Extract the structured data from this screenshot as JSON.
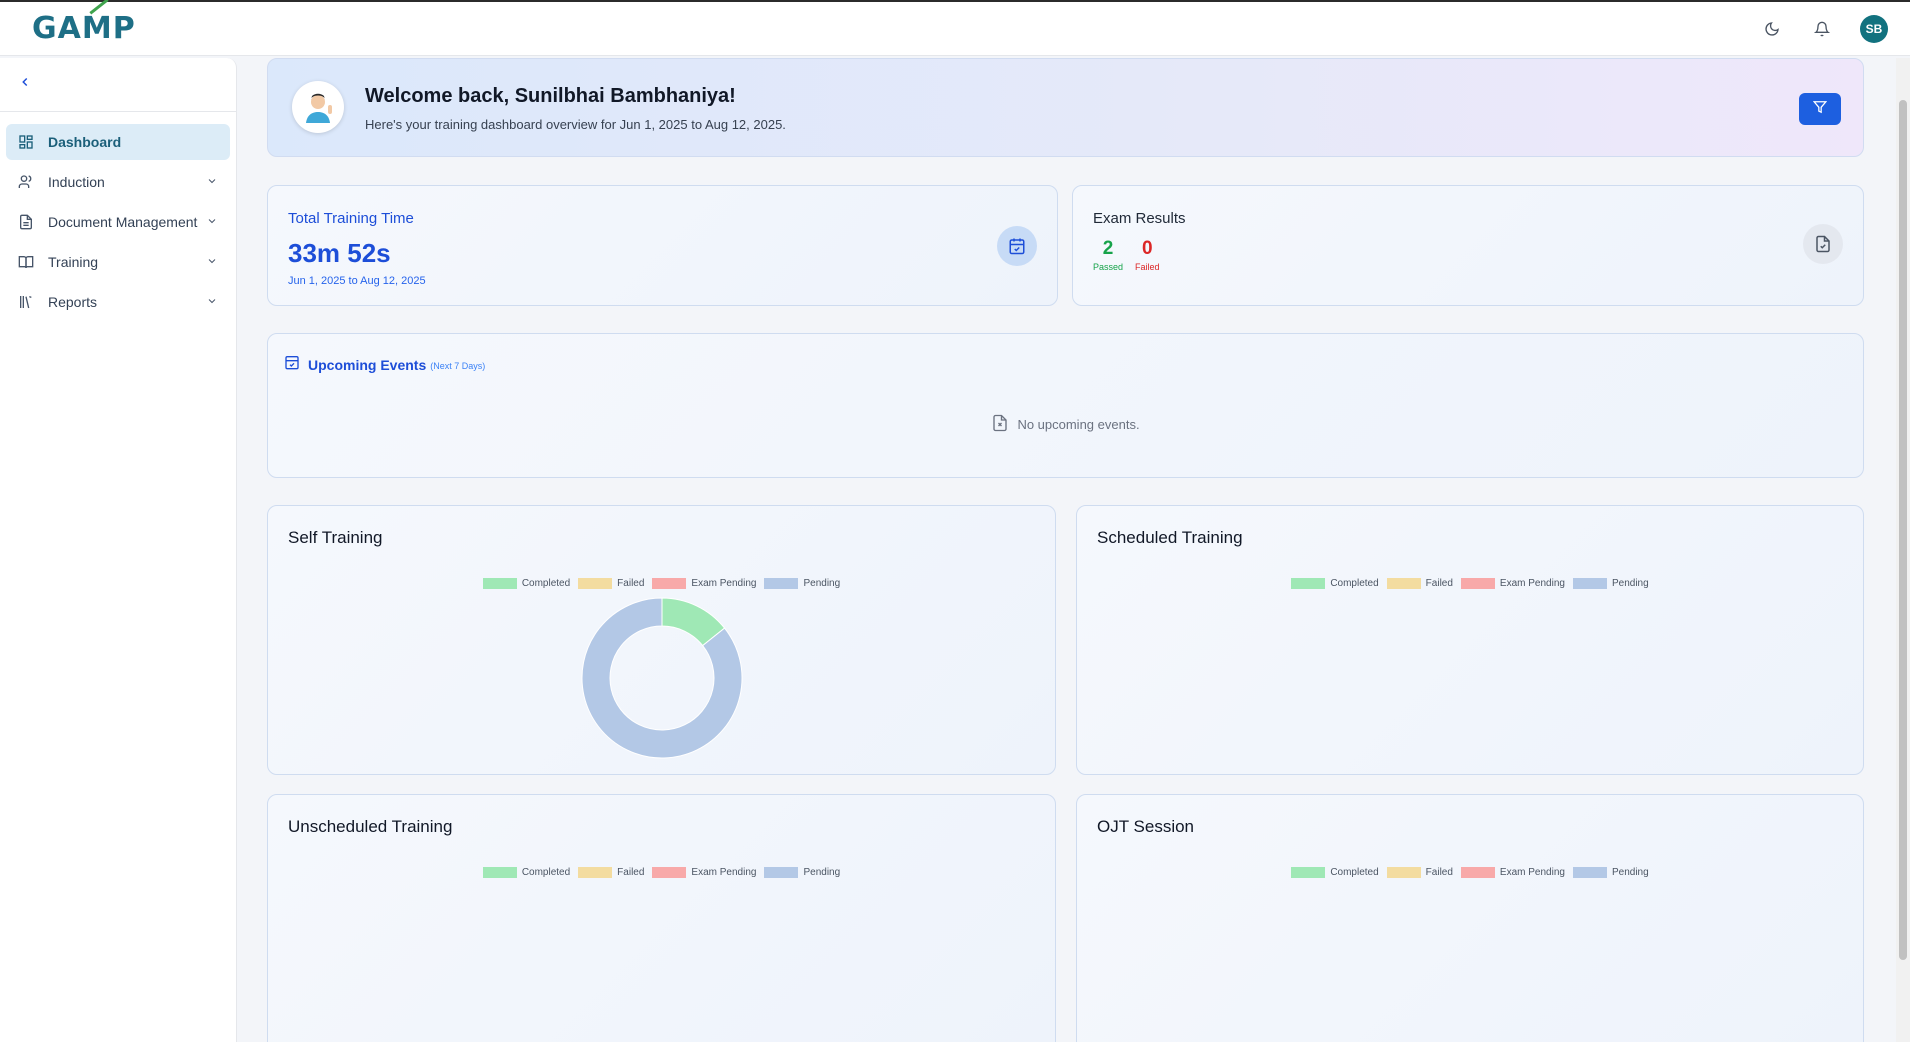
{
  "app": {
    "logo": "GAMP",
    "user_initials": "SB"
  },
  "icons": {
    "theme": "moon-icon",
    "notifications": "bell-icon",
    "filter": "filter-icon"
  },
  "sidebar": {
    "items": [
      {
        "label": "Dashboard",
        "icon": "dashboard-icon",
        "active": true
      },
      {
        "label": "Induction",
        "icon": "users-icon"
      },
      {
        "label": "Document Management",
        "icon": "document-icon"
      },
      {
        "label": "Training",
        "icon": "book-icon"
      },
      {
        "label": "Reports",
        "icon": "library-icon"
      }
    ]
  },
  "welcome": {
    "title": "Welcome back, Sunilbhai Bambhaniya!",
    "subtitle": "Here's your training dashboard overview for Jun 1, 2025 to Aug 12, 2025."
  },
  "training_time": {
    "label": "Total Training Time",
    "value": "33m 52s",
    "range": "Jun 1, 2025 to Aug 12, 2025"
  },
  "exam_results": {
    "label": "Exam Results",
    "passed": "2",
    "passed_label": "Passed",
    "failed": "0",
    "failed_label": "Failed"
  },
  "events": {
    "title": "Upcoming Events",
    "subtitle": "(Next 7 Days)",
    "empty": "No upcoming events."
  },
  "colors": {
    "completed": "#9fe8b5",
    "failed": "#f3dca0",
    "exam_pending": "#f8a9a9",
    "pending": "#b3c8e6",
    "accent": "#1d4ed8"
  },
  "legend": [
    "Completed",
    "Failed",
    "Exam Pending",
    "Pending"
  ],
  "charts": {
    "self": {
      "title": "Self Training"
    },
    "scheduled": {
      "title": "Scheduled Training"
    },
    "unscheduled": {
      "title": "Unscheduled Training"
    },
    "ojt": {
      "title": "OJT Session"
    }
  },
  "chart_data": [
    {
      "type": "pie",
      "title": "Self Training",
      "categories": [
        "Completed",
        "Failed",
        "Exam Pending",
        "Pending"
      ],
      "values": [
        1,
        0,
        0,
        6
      ],
      "legend": "top"
    },
    {
      "type": "pie",
      "title": "Scheduled Training",
      "categories": [
        "Completed",
        "Failed",
        "Exam Pending",
        "Pending"
      ],
      "values": [],
      "legend": "top"
    },
    {
      "type": "pie",
      "title": "Unscheduled Training",
      "categories": [
        "Completed",
        "Failed",
        "Exam Pending",
        "Pending"
      ],
      "values": [],
      "legend": "top"
    },
    {
      "type": "pie",
      "title": "OJT Session",
      "categories": [
        "Completed",
        "Failed",
        "Exam Pending",
        "Pending"
      ],
      "values": [],
      "legend": "top"
    }
  ]
}
